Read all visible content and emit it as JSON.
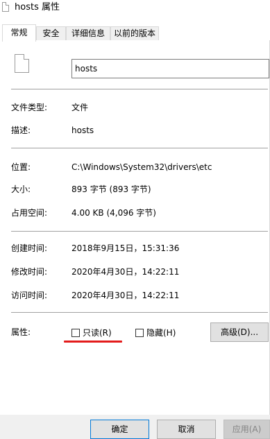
{
  "window": {
    "title": "hosts 属性"
  },
  "tabs": [
    {
      "label": "常规",
      "active": true
    },
    {
      "label": "安全",
      "active": false
    },
    {
      "label": "详细信息",
      "active": false
    },
    {
      "label": "以前的版本",
      "active": false
    }
  ],
  "general": {
    "file_name": "hosts",
    "type_label": "文件类型:",
    "type_value": "文件",
    "desc_label": "描述:",
    "desc_value": "hosts",
    "location_label": "位置:",
    "location_value": "C:\\Windows\\System32\\drivers\\etc",
    "size_label": "大小:",
    "size_value": "893 字节 (893 字节)",
    "disk_label": "占用空间:",
    "disk_value": "4.00 KB (4,096 字节)",
    "created_label": "创建时间:",
    "created_value": "2018年9月15日，15:31:36",
    "modified_label": "修改时间:",
    "modified_value": "2020年4月30日，14:22:11",
    "accessed_label": "访问时间:",
    "accessed_value": "2020年4月30日，14:22:11",
    "attributes_label": "属性:",
    "readonly_label": "只读(R)",
    "readonly_checked": false,
    "hidden_label": "隐藏(H)",
    "hidden_checked": false,
    "advanced_label": "高级(D)..."
  },
  "buttons": {
    "ok": "确定",
    "cancel": "取消",
    "apply": "应用(A)"
  },
  "colors": {
    "annotation": "#e31b1b",
    "focus_border": "#0078d7"
  }
}
